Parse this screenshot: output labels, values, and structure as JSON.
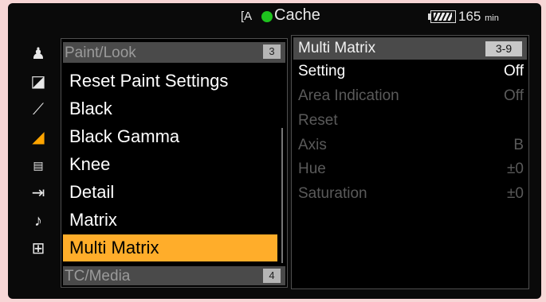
{
  "status": {
    "mode": "[A",
    "media": "Cache",
    "battery_minutes": "165",
    "battery_unit": "min",
    "colors": {
      "record_dot": "#1ec21e"
    }
  },
  "sidebar": {
    "icons": [
      {
        "name": "user-menu-icon",
        "glyph": "♟"
      },
      {
        "name": "camera-icon",
        "glyph": "◪"
      },
      {
        "name": "clapperboard-icon",
        "glyph": "⟋"
      },
      {
        "name": "paint-look-icon",
        "glyph": "◢"
      },
      {
        "name": "timecode-icon",
        "glyph": "▤"
      },
      {
        "name": "output-icon",
        "glyph": "⇥"
      },
      {
        "name": "audio-icon",
        "glyph": "♪"
      },
      {
        "name": "system-icon",
        "glyph": "⊞"
      }
    ]
  },
  "menu": {
    "category": "Paint/Look",
    "category_number": "3",
    "items": [
      "Reset Paint Settings",
      "Black",
      "Black Gamma",
      "Knee",
      "Detail",
      "Matrix",
      "Multi Matrix"
    ],
    "selected": "Multi Matrix",
    "next_category": "TC/Media",
    "next_category_number": "4",
    "colors": {
      "highlight": "#ffad2a"
    }
  },
  "detail": {
    "title": "Multi Matrix",
    "page": "3-9",
    "rows": [
      {
        "label": "Setting",
        "value": "Off"
      },
      {
        "label": "Area Indication",
        "value": "Off"
      },
      {
        "label": "Reset",
        "value": ""
      },
      {
        "label": "Axis",
        "value": "B"
      },
      {
        "label": "Hue",
        "value": "±0"
      },
      {
        "label": "Saturation",
        "value": "±0"
      }
    ]
  }
}
